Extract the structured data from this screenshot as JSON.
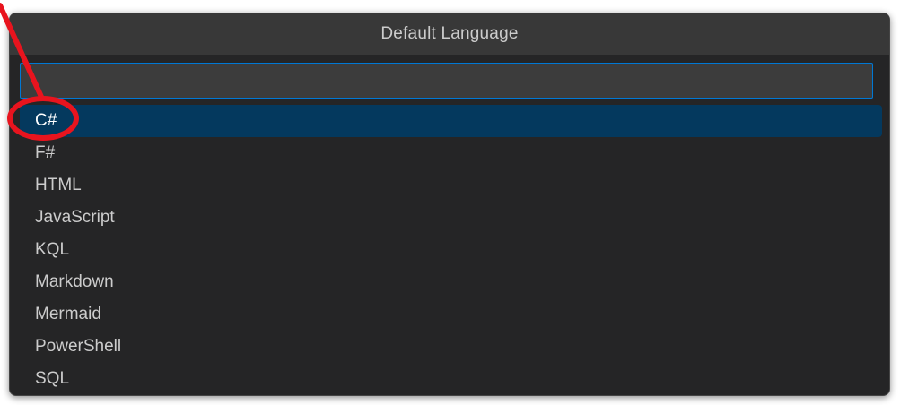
{
  "dialog": {
    "title": "Default Language",
    "search": {
      "value": "",
      "placeholder": ""
    },
    "items": [
      {
        "label": "C#",
        "selected": true
      },
      {
        "label": "F#",
        "selected": false
      },
      {
        "label": "HTML",
        "selected": false
      },
      {
        "label": "JavaScript",
        "selected": false
      },
      {
        "label": "KQL",
        "selected": false
      },
      {
        "label": "Markdown",
        "selected": false
      },
      {
        "label": "Mermaid",
        "selected": false
      },
      {
        "label": "PowerShell",
        "selected": false
      },
      {
        "label": "SQL",
        "selected": false
      }
    ]
  },
  "colors": {
    "background": "#252526",
    "title_bar": "#383838",
    "input_border": "#0078d4",
    "selected_row": "#04395e",
    "annotation": "#e8141e"
  }
}
